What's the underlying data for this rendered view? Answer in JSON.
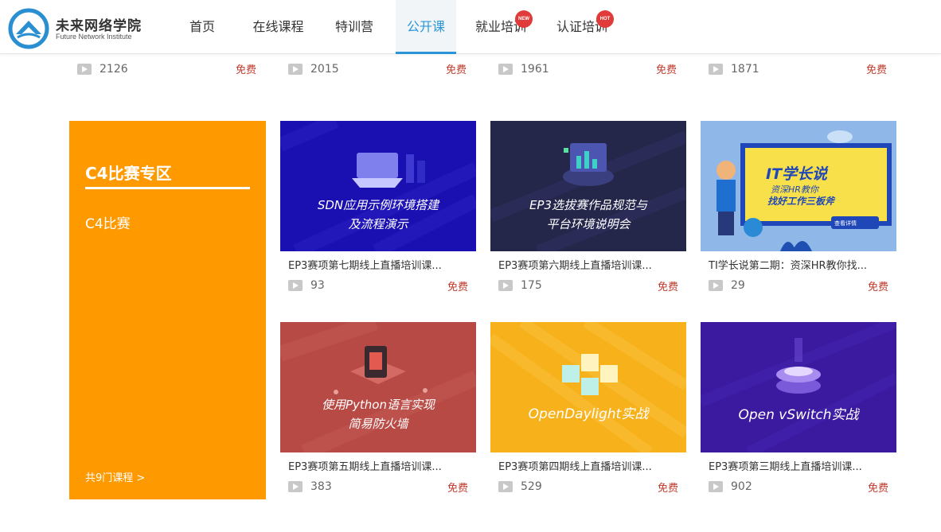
{
  "header": {
    "brand_cn": "未来网络学院",
    "brand_en": "Future Network Institute",
    "nav": [
      {
        "label": "首页",
        "active": false
      },
      {
        "label": "在线课程",
        "active": false
      },
      {
        "label": "特训营",
        "active": false
      },
      {
        "label": "公开课",
        "active": true
      },
      {
        "label": "就业培训",
        "badge": "NEW"
      },
      {
        "label": "认证培训",
        "badge": "HOT"
      }
    ]
  },
  "top_row": [
    {
      "count": "2126",
      "price": "免费"
    },
    {
      "count": "2015",
      "price": "免费"
    },
    {
      "count": "1961",
      "price": "免费"
    },
    {
      "count": "1871",
      "price": "免费"
    }
  ],
  "promo": {
    "title": "C4比赛专区",
    "subtitle": "C4比赛",
    "more": "共9门课程 >"
  },
  "courses": [
    {
      "thumb_line1": "SDN应用示例环境搭建",
      "thumb_line2": "及流程演示",
      "title": "EP3赛项第七期线上直播培训课...",
      "count": "93",
      "price": "免费",
      "bg": "#1a0fb0"
    },
    {
      "thumb_line1": "EP3选拔赛作品规范与",
      "thumb_line2": "平台环境说明会",
      "title": "EP3赛项第六期线上直播培训课...",
      "count": "175",
      "price": "免费",
      "bg": "#24264a"
    },
    {
      "thumb_line1": "IT学长说",
      "thumb_line2": "资深HR教你",
      "thumb_line3": "找好工作三板斧",
      "thumb_button": "查看详情",
      "title": "TI学长说第二期：资深HR教你找...",
      "count": "29",
      "price": "免费",
      "bg": "#8fb8e8"
    },
    {
      "thumb_line1": "使用Python语言实现",
      "thumb_line2": "简易防火墙",
      "title": "EP3赛项第五期线上直播培训课...",
      "count": "383",
      "price": "免费",
      "bg": "#b84a45"
    },
    {
      "thumb_line1": "OpenDaylight实战",
      "thumb_line2": "",
      "title": "EP3赛项第四期线上直播培训课...",
      "count": "529",
      "price": "免费",
      "bg": "#f7b21b"
    },
    {
      "thumb_line1": "Open vSwitch实战",
      "thumb_line2": "",
      "title": "EP3赛项第三期线上直播培训课...",
      "count": "902",
      "price": "免费",
      "bg": "#3b1aa0"
    }
  ]
}
